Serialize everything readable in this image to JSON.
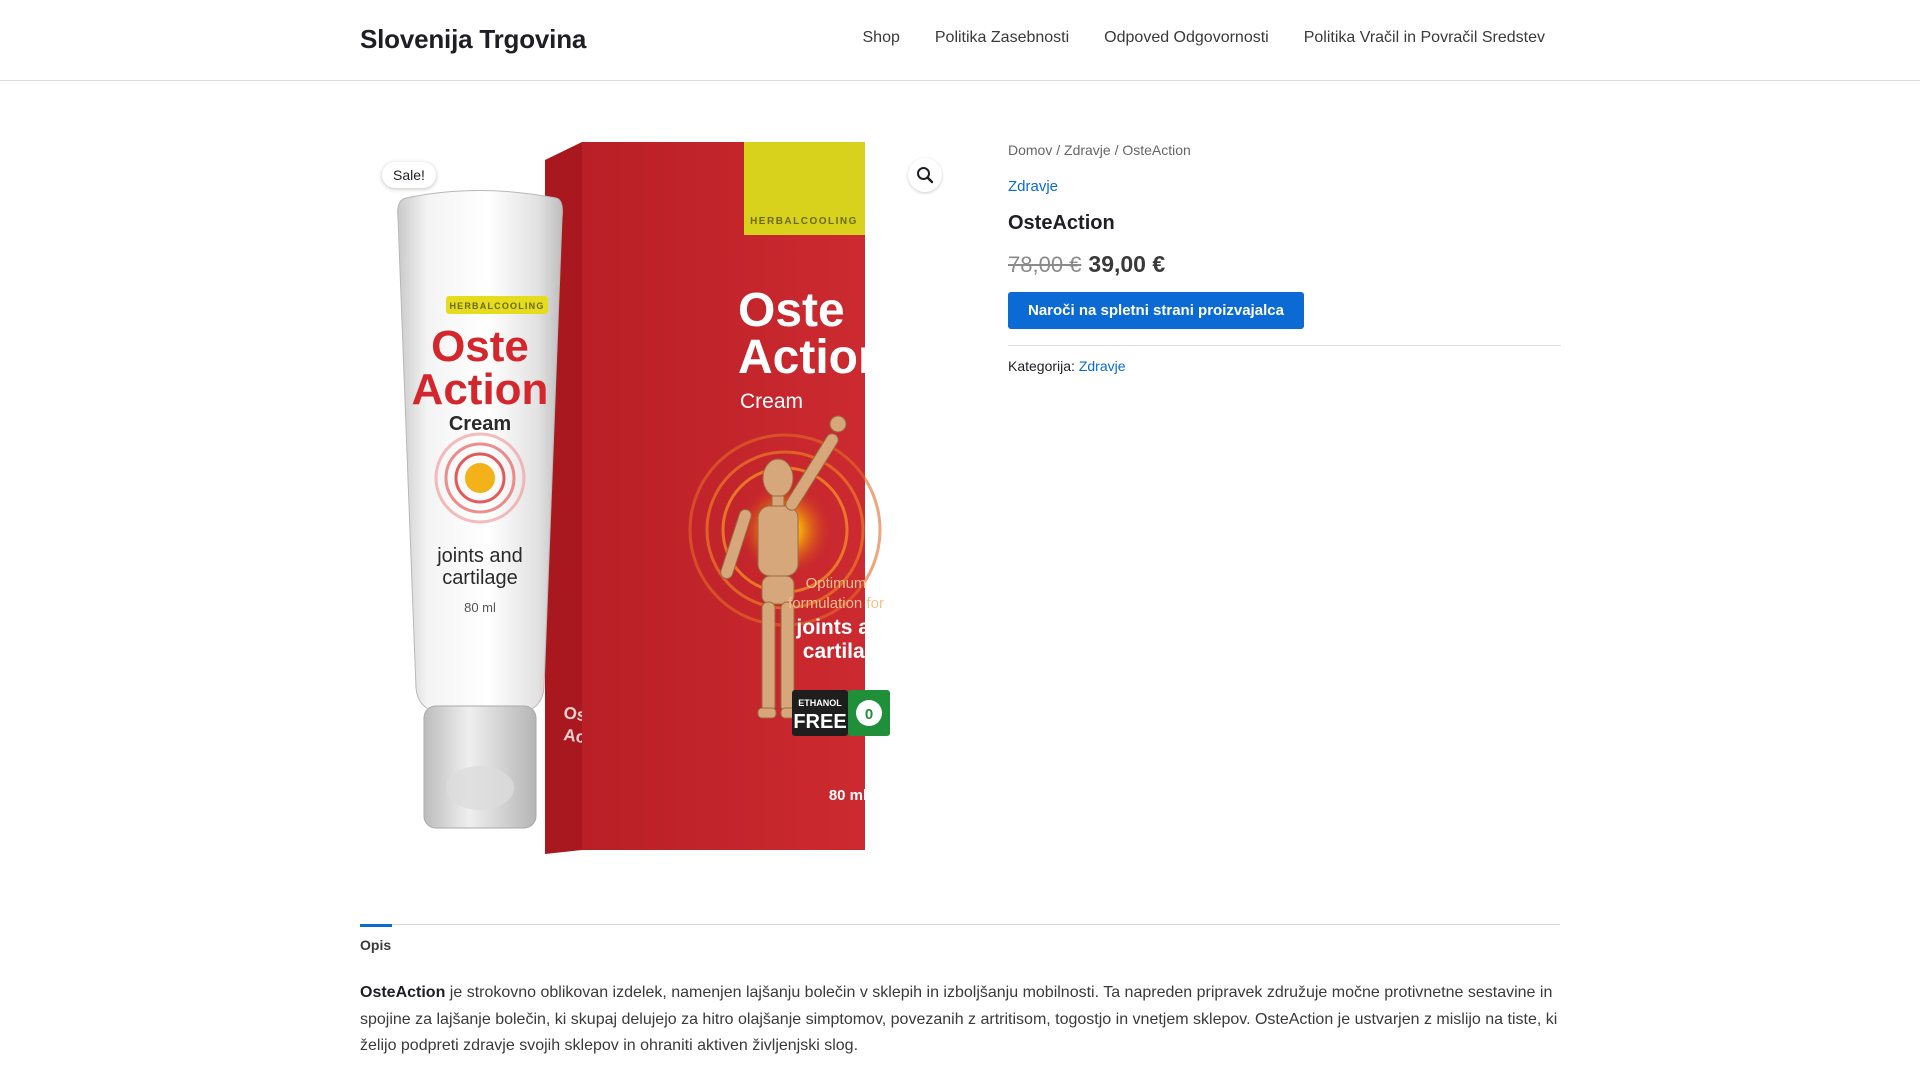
{
  "site": {
    "title": "Slovenija Trgovina",
    "nav": [
      {
        "label": "Shop"
      },
      {
        "label": "Politika Zasebnosti"
      },
      {
        "label": "Odpoved Odgovornosti"
      },
      {
        "label": "Politika Vračil in Povračil Sredstev"
      }
    ]
  },
  "gallery": {
    "sale_badge": "Sale!",
    "zoom_icon": "magnifier-icon",
    "tube": {
      "brand": "HERBALCOOLING",
      "name_line1": "Oste",
      "name_line2": "Action",
      "type": "Cream",
      "desc_line1": "joints and",
      "desc_line2": "cartilage",
      "volume": "80 ml"
    },
    "box": {
      "brand": "HERBALCOOLING",
      "name_line1": "Oste",
      "name_line2": "Action",
      "type": "Cream",
      "tag_line1": "Optimum",
      "tag_line2": "formulation for",
      "desc_line1": "joints and",
      "desc_line2": "cartilage",
      "badge_line1": "ETHANOL",
      "badge_line2": "FREE",
      "badge_num": "0",
      "spine_line1": "Oste",
      "spine_line2": "Action",
      "volume": "80 ml"
    }
  },
  "product": {
    "breadcrumb": "Domov / Zdravje / OsteAction",
    "category_link": "Zdravje",
    "title": "OsteAction",
    "price_old": "78,00 €",
    "price_new": "39,00 €",
    "order_button": "Naroči na spletni strani proizvajalca",
    "meta_label": "Kategorija:",
    "meta_value": "Zdravje"
  },
  "tabs": {
    "active": "Opis"
  },
  "description": {
    "lead": "OsteAction",
    "body": " je strokovno oblikovan izdelek, namenjen lajšanju bolečin v sklepih in izboljšanju mobilnosti. Ta napreden pripravek združuje močne protivnetne sestavine in spojine za lajšanje bolečin, ki skupaj delujejo za hitro olajšanje simptomov, povezanih z artritisom, togostjo in vnetjem sklepov. OsteAction je ustvarjen z mislijo na tiste, ki želijo podpreti zdravje svojih sklepov in ohraniti aktiven življenjski slog."
  },
  "colors": {
    "accent": "#0b6ad4",
    "box_red": "#c8262c",
    "box_yellow": "#d9d21c"
  }
}
